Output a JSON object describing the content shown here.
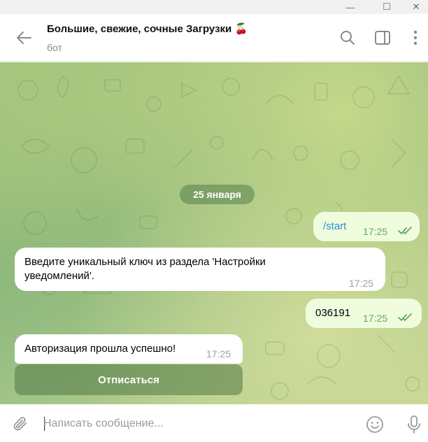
{
  "window": {
    "minimize_glyph": "—",
    "maximize_glyph": "☐",
    "close_glyph": "✕"
  },
  "header": {
    "back_icon": "back-arrow-icon",
    "title": "Большие, свежие, сочные Загрузки",
    "title_emoji": "🍒",
    "subtitle": "бот",
    "icons": [
      "search-icon",
      "sidebar-toggle-icon",
      "more-vertical-icon"
    ]
  },
  "chat": {
    "date_divider": "25 января",
    "messages": [
      {
        "direction": "out",
        "text": "/start",
        "is_command": true,
        "time": "17:25",
        "read": true
      },
      {
        "direction": "in",
        "text_lines": [
          "Введите уникальный ключ из раздела 'Настройки",
          "уведомлений'."
        ],
        "time": "17:25"
      },
      {
        "direction": "out",
        "text": "036191",
        "time": "17:25",
        "read": true
      },
      {
        "direction": "in",
        "text": "Авторизация прошла успешно!",
        "time": "17:25"
      }
    ],
    "inline_button": "Отписаться"
  },
  "composer": {
    "placeholder": "Написать сообщение...",
    "icons": [
      "attach-icon",
      "emoji-icon",
      "microphone-icon"
    ]
  },
  "colors": {
    "outgoing_bubble": "#effdde",
    "incoming_bubble": "#ffffff",
    "time_out": "#5fa95c",
    "command_link": "#2a8fd4"
  }
}
